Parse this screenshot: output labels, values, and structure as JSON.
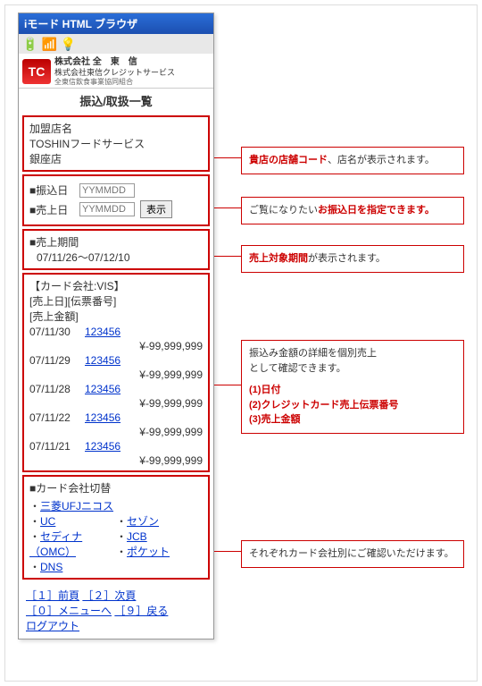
{
  "window": {
    "title": "iモード HTML ブラウザ"
  },
  "status": {
    "batt": "🔋",
    "signal": "📶",
    "light": "💡"
  },
  "logo": {
    "mark": "TC",
    "line1": "株式会社 全　東　信",
    "line2": "株式会社東信クレジットサービス",
    "line3": "全東信飲食事業協同組合"
  },
  "heading": "振込/取扱一覧",
  "merchant": {
    "label": "加盟店名",
    "name": "TOSHINフードサービス",
    "branch": "銀座店"
  },
  "dates": {
    "transfer_label": "■振込日",
    "sales_label": "■売上日",
    "placeholder": "YYMMDD",
    "show_btn": "表示"
  },
  "period": {
    "label": "■売上期間",
    "value": "07/11/26～07/12/10"
  },
  "card": {
    "company_label": "【カード会社:VIS】",
    "header": "[売上日][伝票番号]\n[売上金額]",
    "rows": [
      {
        "date": "07/11/30",
        "num": "123456",
        "amt": "¥-99,999,999"
      },
      {
        "date": "07/11/29",
        "num": "123456",
        "amt": "¥-99,999,999"
      },
      {
        "date": "07/11/28",
        "num": "123456",
        "amt": "¥-99,999,999"
      },
      {
        "date": "07/11/22",
        "num": "123456",
        "amt": "¥-99,999,999"
      },
      {
        "date": "07/11/21",
        "num": "123456",
        "amt": "¥-99,999,999"
      }
    ]
  },
  "switch": {
    "label": "■カード会社切替",
    "col1": [
      "三菱UFJニコス",
      "UC",
      "セディナ（OMC）",
      "DNS"
    ],
    "col2": [
      "セゾン",
      "JCB",
      "ポケット"
    ]
  },
  "footer": {
    "prev": "［１］前頁",
    "next": "［２］次頁",
    "menu": "［０］メニューへ",
    "back": "［９］戻る",
    "logout": "ログアウト"
  },
  "callouts": {
    "c1_a": "貴店の店舗コード",
    "c1_b": "、店名が表示されます。",
    "c2_a": "ご覧になりたい",
    "c2_b": "お振込日を指定できます。",
    "c3_a": "売上対象期間",
    "c3_b": "が表示されます。",
    "c4_a": "振込み金額の詳細を個別売上\nとして確認できます。",
    "c4_1": "(1)日付",
    "c4_2": "(2)クレジットカード売上伝票番号",
    "c4_3": "(3)売上金額",
    "c5": "それぞれカード会社別にご確認いただけます。"
  }
}
